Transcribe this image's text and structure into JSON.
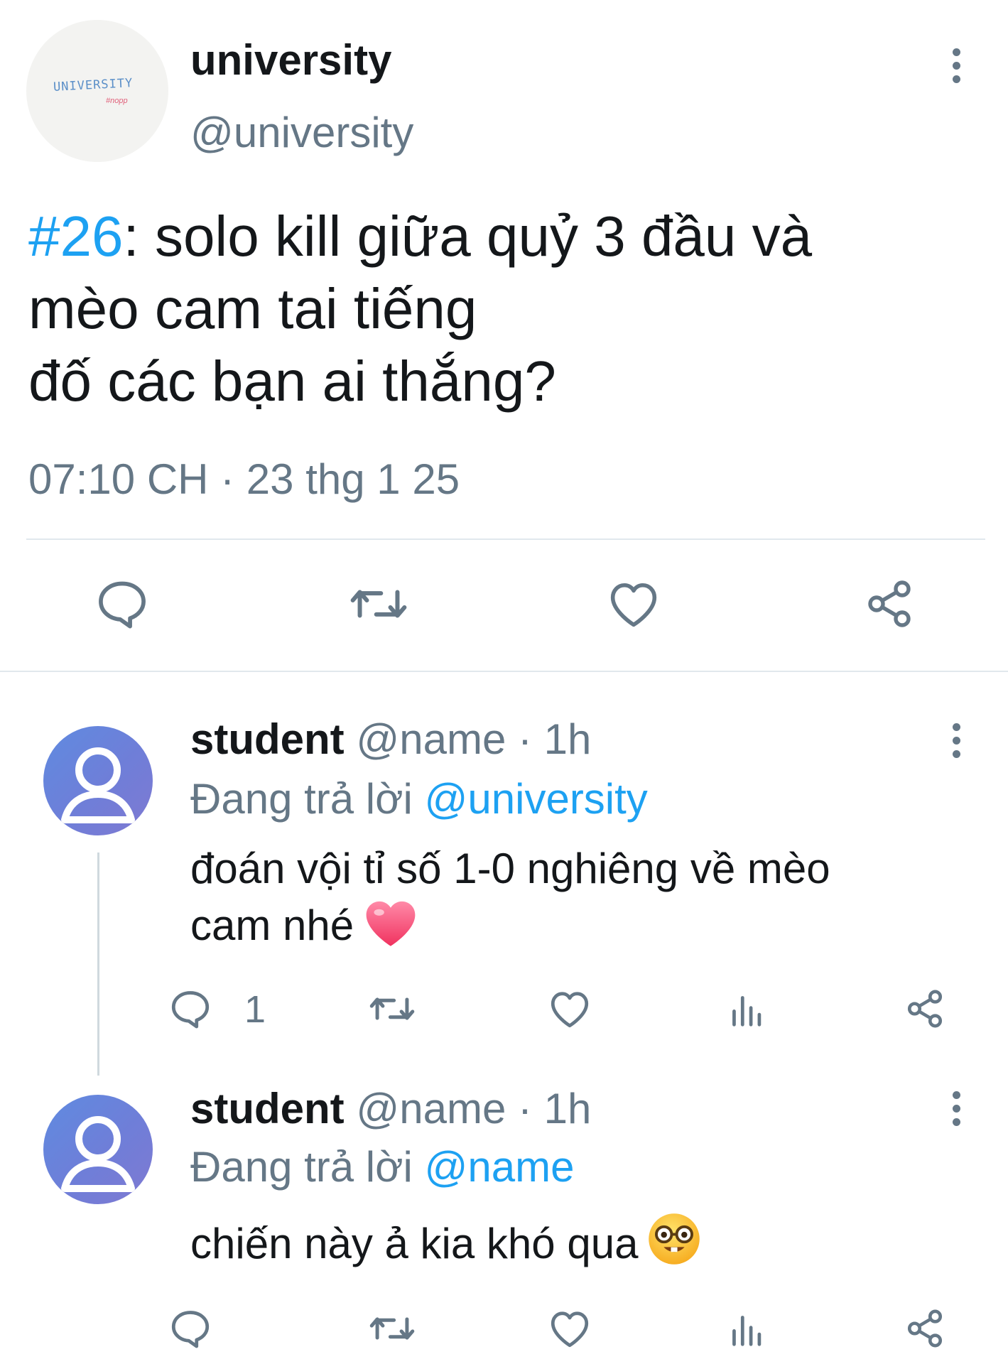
{
  "main_tweet": {
    "avatar": {
      "text": "UNIVERSITY",
      "subtext": "#nopp"
    },
    "display_name": "university",
    "handle": "@university",
    "text": {
      "hashtag": "#26",
      "line1_rest": ": solo kill giữa quỷ 3 đầu và",
      "line2": "mèo cam tai tiếng",
      "line3": "đố các bạn ai thắng?"
    },
    "timestamp": "07:10 CH · 23 thg 1 25",
    "actions": [
      "reply-icon",
      "retweet-icon",
      "like-icon",
      "share-icon"
    ]
  },
  "replies": [
    {
      "display_name": "student",
      "meta": "@name · 1h",
      "replying_prefix": "Đang trả lời",
      "replying_to": "@university",
      "text_line1": "đoán vội tỉ số 1-0 nghiêng về mèo",
      "text_line2": "cam nhé",
      "emoji": "heart",
      "reply_count": "1",
      "actions": [
        "reply-icon",
        "retweet-icon",
        "like-icon",
        "analytics-icon",
        "share-icon"
      ]
    },
    {
      "display_name": "student",
      "meta": "@name · 1h",
      "replying_prefix": "Đang trả lời",
      "replying_to": "@name",
      "text_line1": "chiến này ả kia khó qua",
      "emoji": "nerd-face",
      "actions": [
        "reply-icon",
        "retweet-icon",
        "like-icon",
        "analytics-icon",
        "share-icon"
      ]
    }
  ],
  "colors": {
    "text": "#14171a",
    "secondary": "#657786",
    "accent": "#1da1f2",
    "divider": "#e1e8ed"
  }
}
